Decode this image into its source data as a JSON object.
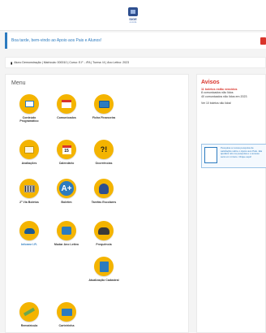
{
  "header": {
    "logo_text": "SIGE",
    "logo_sub": "escola"
  },
  "welcome": {
    "message": "Boa tarde, bem-vindo ao Apoio aos Pais e Alunos!"
  },
  "info": {
    "text": "Aluno Demonstração | Matrícula: 000010 | Curso: E.F - 4ºA | Turma: I4 | Ano Letivo: 2023"
  },
  "menu": {
    "title": "Menu",
    "items": [
      {
        "label": "Conteúdo Programático"
      },
      {
        "label": "Comunicados"
      },
      {
        "label": "Ficha Financeira"
      },
      {
        "label": "Avaliações"
      },
      {
        "label": "Calendário",
        "day": "15"
      },
      {
        "label": "Ocorrências",
        "glyph": "?!"
      },
      {
        "label": "2ª Via Boletos"
      },
      {
        "label": "Boletim",
        "glyph": "A+"
      },
      {
        "label": "Tarefas Escolares"
      },
      {
        "label": "Informe I.R."
      },
      {
        "label": "Mudar Ano Letivo"
      },
      {
        "label": "Frequência"
      },
      {
        "label": "Atualização Cadastral"
      },
      {
        "label": "Rematrícula"
      },
      {
        "label": "Carteirinha"
      }
    ]
  },
  "notices": {
    "title": "Avisos",
    "alert": "11 boletos estão vencidos",
    "lines": [
      "8 comunicados não lidos",
      "40 comunicados não lidos em 2023"
    ],
    "link": "Ver 10 boletos não lidos!",
    "survey": "Pesquisa a nossa pesquisa de satisfação sobre o Apoio aos Pais. Ela ajudará nós na pesquisa e o acesso será um minuto. Clique aqui!"
  },
  "colors": {
    "accent": "#2c7bbf",
    "alert": "#d9342b",
    "icon_bg": "#f4b400"
  }
}
